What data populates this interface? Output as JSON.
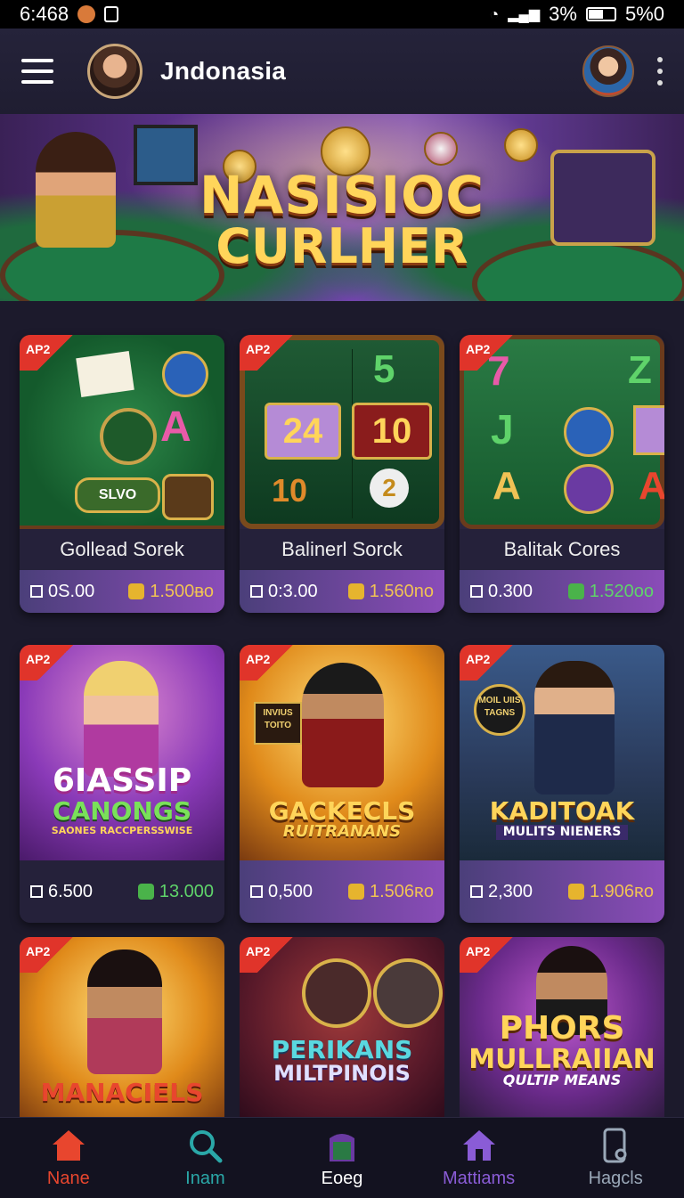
{
  "status_bar": {
    "time": "6:468",
    "signal_text": "3%",
    "battery_text": "5%0"
  },
  "header": {
    "title": "Jndonasia"
  },
  "banner": {
    "line1": "NASISIOC",
    "line2": "CURLHER"
  },
  "cards": [
    {
      "badge": "AP2",
      "name": "Gollead Sorek",
      "stat_a": "0S.00",
      "stat_b": "1.500ᴃo",
      "coin_color": "gold"
    },
    {
      "badge": "AP2",
      "name": "Balinerl Sorck",
      "stat_a": "0:3.00",
      "stat_b": "1.560no",
      "coin_color": "gold"
    },
    {
      "badge": "AP2",
      "name": "Balitak Cores",
      "stat_a": "0.300",
      "stat_b": "1.520oo",
      "coin_color": "green"
    },
    {
      "badge": "AP2",
      "art_title": "6IASSIP",
      "art_sub": "CANONGS",
      "art_sub2": "SAONES RACCPERSSWISE",
      "stat_a": "6.500",
      "stat_b": "13.000",
      "coin_color": "green"
    },
    {
      "badge": "AP2",
      "art_title": "GACKECLS",
      "art_sub": "RUITRANANS",
      "art_sign": "INVIUS TOITO",
      "stat_a": "0,500",
      "stat_b": "1.506ʀo",
      "coin_color": "gold"
    },
    {
      "badge": "AP2",
      "art_title": "KADITOAK",
      "art_sub": "MULITS NIENERS",
      "art_sign": "MOIL UIIS TAGNS",
      "stat_a": "2,300",
      "stat_b": "1.906ʀo",
      "coin_color": "gold"
    }
  ],
  "partial_cards": [
    {
      "badge": "AP2",
      "art_title": "MANACIELS"
    },
    {
      "badge": "AP2",
      "art_title": "PERIKANS",
      "art_sub": "MILTPINOIS"
    },
    {
      "badge": "AP2",
      "art_title": "PHORS",
      "art_sub": "MULLRAIIAN",
      "art_sub2": "QULTIP MEANS"
    }
  ],
  "nav": [
    {
      "label": "Nane",
      "icon": "home-icon",
      "color": "#e8462e"
    },
    {
      "label": "Inam",
      "icon": "search-icon",
      "color": "#2aa8a8"
    },
    {
      "label": "Eoeg",
      "icon": "bag-icon",
      "color": "#ffffff"
    },
    {
      "label": "Mattiams",
      "icon": "house-purple-icon",
      "color": "#8a5cd6"
    },
    {
      "label": "Hagcls",
      "icon": "phone-icon",
      "color": "#9aa8b8"
    }
  ]
}
